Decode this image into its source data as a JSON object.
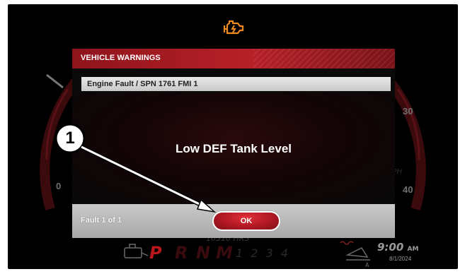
{
  "header": {
    "engine_icon": "check-engine-icon",
    "engine_icon_color": "#f08a1c"
  },
  "dialog": {
    "title": "VEHICLE WARNINGS",
    "fault_code": "Engine Fault / SPN 1761 FMI 1",
    "message": "Low DEF Tank Level",
    "fault_count": "Fault 1 of 1",
    "ok_label": "OK",
    "accent_color": "#b01822"
  },
  "gauges": {
    "left_ticks": [
      "0"
    ],
    "right_ticks": [
      "30",
      "40"
    ]
  },
  "status_bar": {
    "gears": [
      "P",
      "R",
      "N",
      "M"
    ],
    "gear_numbers": "1 2 3 4",
    "time": "9:00",
    "ampm": "AM",
    "date": "8/1/2024",
    "left_icon": "def-fluid-icon",
    "right_icon": "trailer-tilt-icon"
  },
  "callout": {
    "number": "1"
  }
}
